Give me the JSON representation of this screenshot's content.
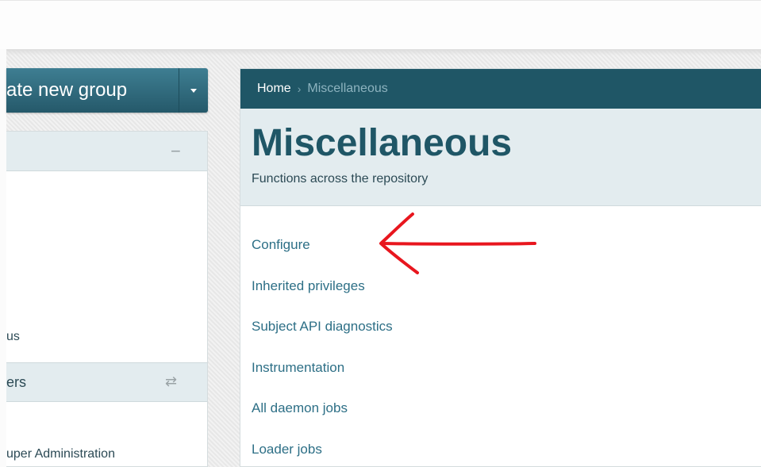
{
  "colors": {
    "brand_dark": "#1f5666",
    "link": "#2d6f86",
    "panel_header_bg": "#e3ecef",
    "annotation_arrow": "#e8161e"
  },
  "left": {
    "create_button_label": "ate new group",
    "item_status": "us",
    "subheader_label": "ers",
    "item_admin": "uper Administration"
  },
  "breadcrumb": {
    "home": "Home",
    "separator": "›",
    "current": "Miscellaneous"
  },
  "page": {
    "title": "Miscellaneous",
    "subtitle": "Functions across the repository"
  },
  "links": [
    "Configure",
    "Inherited privileges",
    "Subject API diagnostics",
    "Instrumentation",
    "All daemon jobs",
    "Loader jobs"
  ],
  "icons": {
    "collapse": "minus-icon",
    "swap": "swap-arrows-icon",
    "dropdown": "caret-down-icon",
    "annotation": "red-arrow-icon"
  }
}
